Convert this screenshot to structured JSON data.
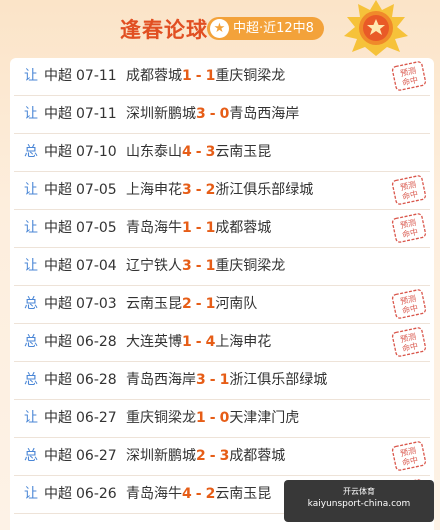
{
  "header": {
    "title": "逢春论球",
    "pill": "中超·近12中8",
    "pill_icon": "star-icon"
  },
  "rows": [
    {
      "kind": "让",
      "league": "中超",
      "date": "07-11",
      "home": "成都蓉城",
      "hs": "1",
      "sep": "-",
      "as": "1",
      "away": "重庆铜梁龙",
      "hit": true
    },
    {
      "kind": "让",
      "league": "中超",
      "date": "07-11",
      "home": "深圳新鹏城",
      "hs": "3",
      "sep": "-",
      "as": "0",
      "away": "青岛西海岸",
      "hit": false
    },
    {
      "kind": "总",
      "league": "中超",
      "date": "07-10",
      "home": "山东泰山",
      "hs": "4",
      "sep": "-",
      "as": "3",
      "away": "云南玉昆",
      "hit": false
    },
    {
      "kind": "让",
      "league": "中超",
      "date": "07-05",
      "home": "上海申花",
      "hs": "3",
      "sep": "-",
      "as": "2",
      "away": "浙江俱乐部绿城",
      "hit": true
    },
    {
      "kind": "让",
      "league": "中超",
      "date": "07-05",
      "home": "青岛海牛",
      "hs": "1",
      "sep": "-",
      "as": "1",
      "away": "成都蓉城",
      "hit": true
    },
    {
      "kind": "让",
      "league": "中超",
      "date": "07-04",
      "home": "辽宁铁人",
      "hs": "3",
      "sep": "-",
      "as": "1",
      "away": "重庆铜梁龙",
      "hit": false
    },
    {
      "kind": "总",
      "league": "中超",
      "date": "07-03",
      "home": "云南玉昆",
      "hs": "2",
      "sep": "-",
      "as": "1",
      "away": "河南队",
      "hit": true
    },
    {
      "kind": "总",
      "league": "中超",
      "date": "06-28",
      "home": "大连英博",
      "hs": "1",
      "sep": "-",
      "as": "4",
      "away": "上海申花",
      "hit": true
    },
    {
      "kind": "总",
      "league": "中超",
      "date": "06-28",
      "home": "青岛西海岸",
      "hs": "3",
      "sep": "-",
      "as": "1",
      "away": "浙江俱乐部绿城",
      "hit": false
    },
    {
      "kind": "让",
      "league": "中超",
      "date": "06-27",
      "home": "重庆铜梁龙",
      "hs": "1",
      "sep": "-",
      "as": "0",
      "away": "天津津门虎",
      "hit": false
    },
    {
      "kind": "总",
      "league": "中超",
      "date": "06-27",
      "home": "深圳新鹏城",
      "hs": "2",
      "sep": "-",
      "as": "3",
      "away": "成都蓉城",
      "hit": true
    },
    {
      "kind": "让",
      "league": "中超",
      "date": "06-26",
      "home": "青岛海牛",
      "hs": "4",
      "sep": "-",
      "as": "2",
      "away": "云南玉昆",
      "hit": true
    }
  ],
  "stamp_text": [
    "预测",
    "命中"
  ],
  "watermark": {
    "line1": "开云体育",
    "line2": "kaiyunsport-china.com"
  },
  "colors": {
    "accent": "#e14f22",
    "score": "#e65d17",
    "kind": "#4a86d6",
    "pill": "#f3a23a",
    "stamp": "#d9564b"
  }
}
